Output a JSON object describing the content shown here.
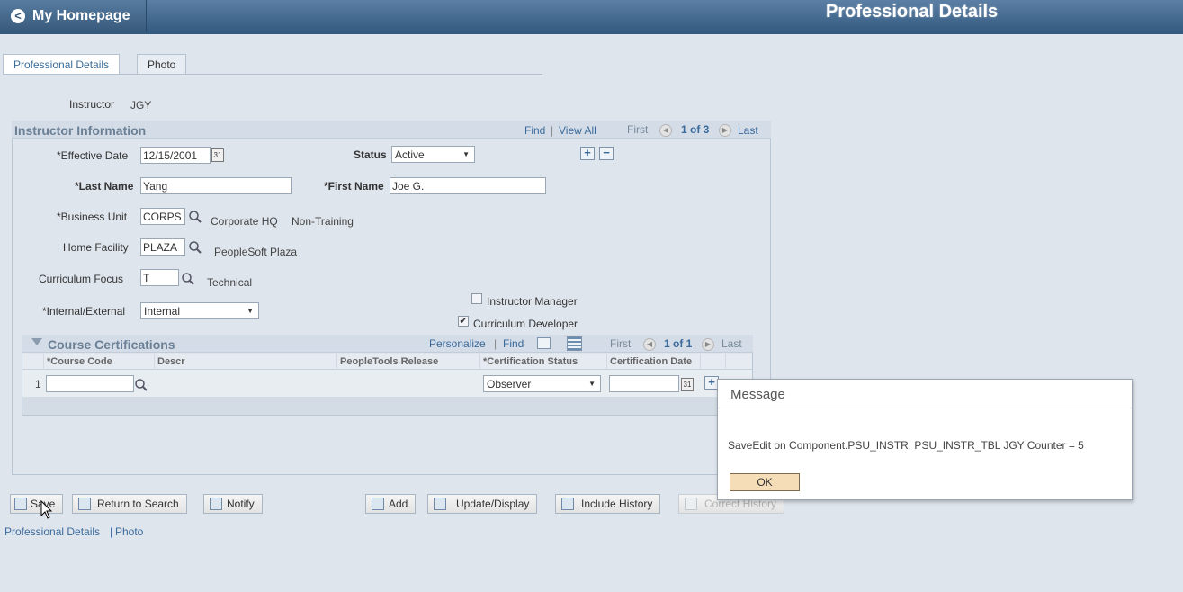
{
  "header": {
    "home_label": "My Homepage",
    "page_title": "Professional Details"
  },
  "tabs": [
    {
      "label": "Professional Details",
      "active": true
    },
    {
      "label": "Photo",
      "active": false
    }
  ],
  "instructor": {
    "label": "Instructor",
    "value": "JGY"
  },
  "instructor_info": {
    "title": "Instructor Information",
    "find": "Find",
    "sep": "|",
    "view_all": "View All",
    "first": "First",
    "count": "1 of 3",
    "last": "Last",
    "effective_date": {
      "label": "*Effective Date",
      "value": "12/15/2001"
    },
    "status": {
      "label": "Status",
      "value": "Active"
    },
    "last_name": {
      "label": "*Last Name",
      "value": "Yang"
    },
    "first_name": {
      "label": "*First Name",
      "value": "Joe G."
    },
    "business_unit": {
      "label": "*Business Unit",
      "value": "CORPS",
      "desc1": "Corporate HQ",
      "desc2": "Non-Training"
    },
    "home_facility": {
      "label": "Home Facility",
      "value": "PLAZA",
      "desc": "PeopleSoft Plaza"
    },
    "curriculum_focus": {
      "label": "Curriculum Focus",
      "value": "T",
      "desc": "Technical"
    },
    "internal_external": {
      "label": "*Internal/External",
      "value": "Internal"
    },
    "instructor_manager": {
      "label": "Instructor Manager",
      "checked": false
    },
    "curriculum_developer": {
      "label": "Curriculum Developer",
      "checked": true
    }
  },
  "certifications": {
    "title": "Course Certifications",
    "personalize": "Personalize",
    "find": "Find",
    "sep": "|",
    "first": "First",
    "count": "1 of 1",
    "last": "Last",
    "columns": [
      "*Course Code",
      "Descr",
      "PeopleTools Release",
      "*Certification Status",
      "Certification Date"
    ],
    "rows": [
      {
        "num": "1",
        "course_code": "",
        "descr": "",
        "release": "",
        "status": "Observer",
        "date": ""
      }
    ]
  },
  "toolbar": {
    "save": "Save",
    "return_to_search": "Return to Search",
    "notify": "Notify",
    "add": "Add",
    "update_display": "Update/Display",
    "include_history": "Include History",
    "correct_history": "Correct History"
  },
  "footer_links": {
    "professional_details": "Professional Details",
    "sep": "|",
    "photo": "Photo"
  },
  "message": {
    "title": "Message",
    "text": "SaveEdit on Component.PSU_INSTR, PSU_INSTR_TBL JGY Counter = 5",
    "ok": "OK"
  }
}
